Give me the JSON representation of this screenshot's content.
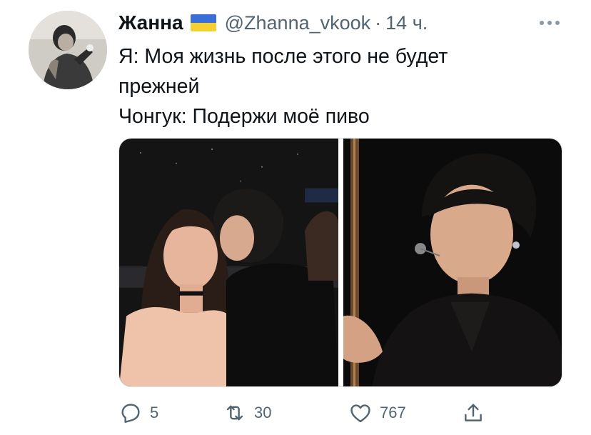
{
  "tweet": {
    "author_name": "Жанна",
    "handle": "@Zhanna_vkook",
    "separator": "·",
    "time": "14 ч.",
    "text_lines": [
      "Я: Моя жизнь после этого не будет",
      "прежней",
      "Чонгук: Подержи моё пиво"
    ]
  },
  "flag": {
    "top_color": "#3b6fd8",
    "bottom_color": "#f5d033"
  },
  "actions": {
    "reply_count": "5",
    "retweet_count": "30",
    "like_count": "767"
  },
  "icons": {
    "more": "more-dots-icon",
    "reply": "reply-icon",
    "retweet": "retweet-icon",
    "like": "heart-icon",
    "share": "share-icon"
  },
  "colors": {
    "text_primary": "#0f1419",
    "text_secondary": "#536471"
  }
}
